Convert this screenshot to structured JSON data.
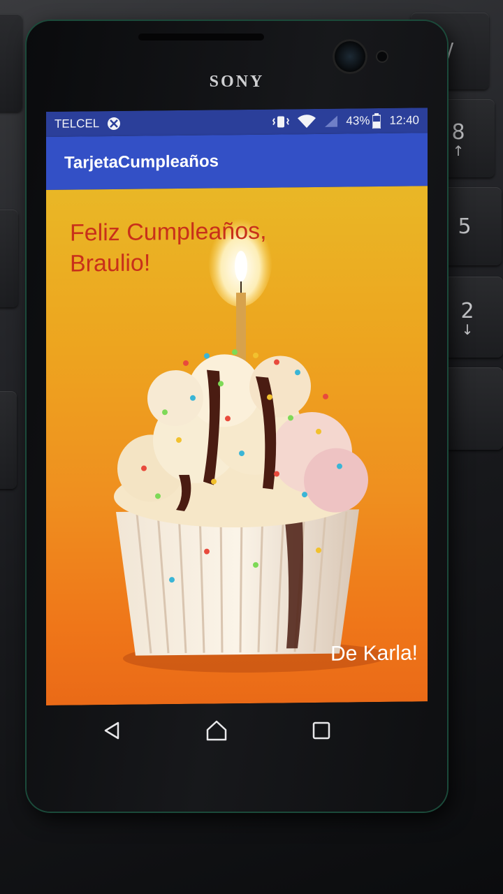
{
  "device": {
    "brand": "SONY"
  },
  "status_bar": {
    "carrier": "TELCEL",
    "battery_percent": "43%",
    "time": "12:40",
    "icons": [
      "no-sim-icon",
      "vibrate-icon",
      "wifi-icon",
      "signal-icon",
      "battery-icon"
    ]
  },
  "app_bar": {
    "title": "TarjetaCumpleaños"
  },
  "card": {
    "greeting_line1": "Feliz Cumpleaños,",
    "greeting_line2": "Braulio!",
    "signature": "De Karla!",
    "image": "cupcake-with-candle"
  },
  "nav_bar": {
    "buttons": [
      "back-icon",
      "home-icon",
      "recents-icon"
    ]
  },
  "keyboard_keys": [
    {
      "main": "/",
      "sub": ""
    },
    {
      "main": "8",
      "sub": "↑"
    },
    {
      "main": "5",
      "sub": ""
    },
    {
      "main": "2",
      "sub": "↓"
    }
  ],
  "colors": {
    "status_bar": "#2b3f9a",
    "app_bar": "#3350c6",
    "greeting_text": "#c8301a",
    "card_top": "#e9b726",
    "card_bottom": "#ea6a17"
  }
}
